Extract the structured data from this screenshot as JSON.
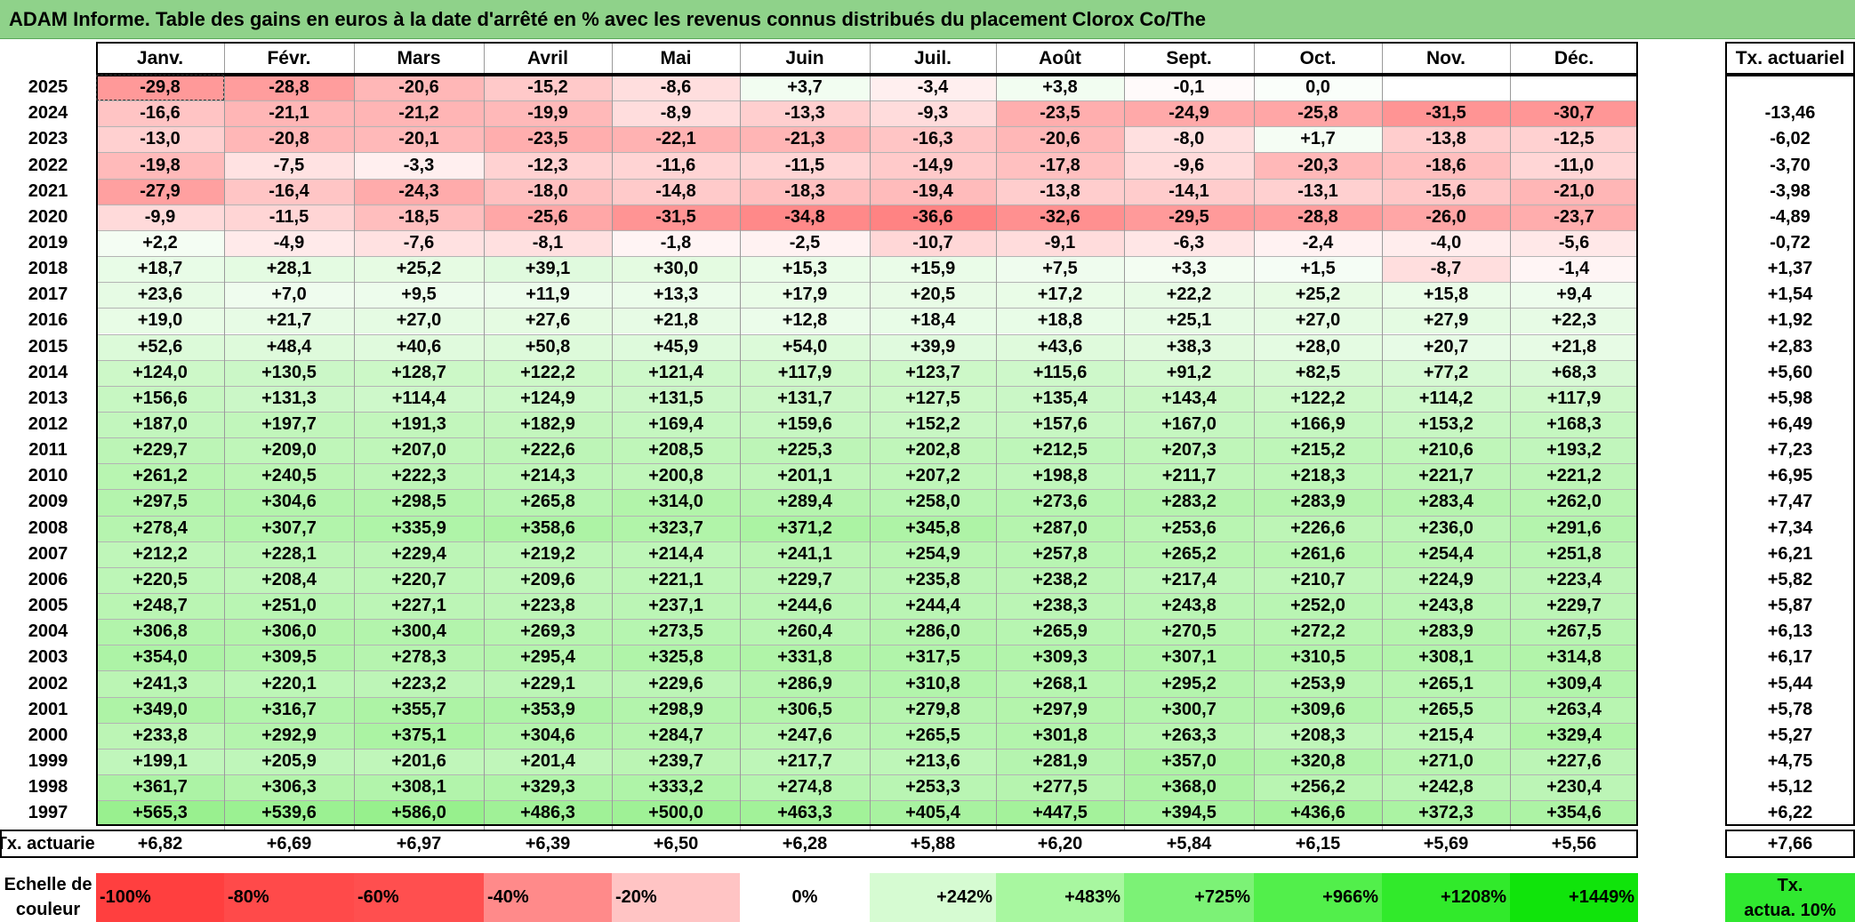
{
  "title": "ADAM Informe. Table des gains en euros à la date d'arrêté en % avec les revenus connus distribués du placement Clorox Co/The",
  "months": [
    "Janv.",
    "Févr.",
    "Mars",
    "Avril",
    "Mai",
    "Juin",
    "Juil.",
    "Août",
    "Sept.",
    "Oct.",
    "Nov.",
    "Déc."
  ],
  "tx_header": "Tx. actuariel",
  "rows": [
    {
      "year": "2025",
      "values": [
        "-29,8",
        "-28,8",
        "-20,6",
        "-15,2",
        "-8,6",
        "+3,7",
        "-3,4",
        "+3,8",
        "-0,1",
        "0,0",
        "",
        ""
      ],
      "tx": ""
    },
    {
      "year": "2024",
      "values": [
        "-16,6",
        "-21,1",
        "-21,2",
        "-19,9",
        "-8,9",
        "-13,3",
        "-9,3",
        "-23,5",
        "-24,9",
        "-25,8",
        "-31,5",
        "-30,7"
      ],
      "tx": "-13,46"
    },
    {
      "year": "2023",
      "values": [
        "-13,0",
        "-20,8",
        "-20,1",
        "-23,5",
        "-22,1",
        "-21,3",
        "-16,3",
        "-20,6",
        "-8,0",
        "+1,7",
        "-13,8",
        "-12,5"
      ],
      "tx": "-6,02"
    },
    {
      "year": "2022",
      "values": [
        "-19,8",
        "-7,5",
        "-3,3",
        "-12,3",
        "-11,6",
        "-11,5",
        "-14,9",
        "-17,8",
        "-9,6",
        "-20,3",
        "-18,6",
        "-11,0"
      ],
      "tx": "-3,70"
    },
    {
      "year": "2021",
      "values": [
        "-27,9",
        "-16,4",
        "-24,3",
        "-18,0",
        "-14,8",
        "-18,3",
        "-19,4",
        "-13,8",
        "-14,1",
        "-13,1",
        "-15,6",
        "-21,0"
      ],
      "tx": "-3,98"
    },
    {
      "year": "2020",
      "values": [
        "-9,9",
        "-11,5",
        "-18,5",
        "-25,6",
        "-31,5",
        "-34,8",
        "-36,6",
        "-32,6",
        "-29,5",
        "-28,8",
        "-26,0",
        "-23,7"
      ],
      "tx": "-4,89"
    },
    {
      "year": "2019",
      "values": [
        "+2,2",
        "-4,9",
        "-7,6",
        "-8,1",
        "-1,8",
        "-2,5",
        "-10,7",
        "-9,1",
        "-6,3",
        "-2,4",
        "-4,0",
        "-5,6"
      ],
      "tx": "-0,72"
    },
    {
      "year": "2018",
      "values": [
        "+18,7",
        "+28,1",
        "+25,2",
        "+39,1",
        "+30,0",
        "+15,3",
        "+15,9",
        "+7,5",
        "+3,3",
        "+1,5",
        "-8,7",
        "-1,4"
      ],
      "tx": "+1,37"
    },
    {
      "year": "2017",
      "values": [
        "+23,6",
        "+7,0",
        "+9,5",
        "+11,9",
        "+13,3",
        "+17,9",
        "+20,5",
        "+17,2",
        "+22,2",
        "+25,2",
        "+15,8",
        "+9,4"
      ],
      "tx": "+1,54"
    },
    {
      "year": "2016",
      "values": [
        "+19,0",
        "+21,7",
        "+27,0",
        "+27,6",
        "+21,8",
        "+12,8",
        "+18,4",
        "+18,8",
        "+25,1",
        "+27,0",
        "+27,9",
        "+22,3"
      ],
      "tx": "+1,92"
    },
    {
      "year": "2015",
      "values": [
        "+52,6",
        "+48,4",
        "+40,6",
        "+50,8",
        "+45,9",
        "+54,0",
        "+39,9",
        "+43,6",
        "+38,3",
        "+28,0",
        "+20,7",
        "+21,8"
      ],
      "tx": "+2,83"
    },
    {
      "year": "2014",
      "values": [
        "+124,0",
        "+130,5",
        "+128,7",
        "+122,2",
        "+121,4",
        "+117,9",
        "+123,7",
        "+115,6",
        "+91,2",
        "+82,5",
        "+77,2",
        "+68,3"
      ],
      "tx": "+5,60"
    },
    {
      "year": "2013",
      "values": [
        "+156,6",
        "+131,3",
        "+114,4",
        "+124,9",
        "+131,5",
        "+131,7",
        "+127,5",
        "+135,4",
        "+143,4",
        "+122,2",
        "+114,2",
        "+117,9"
      ],
      "tx": "+5,98"
    },
    {
      "year": "2012",
      "values": [
        "+187,0",
        "+197,7",
        "+191,3",
        "+182,9",
        "+169,4",
        "+159,6",
        "+152,2",
        "+157,6",
        "+167,0",
        "+166,9",
        "+153,2",
        "+168,3"
      ],
      "tx": "+6,49"
    },
    {
      "year": "2011",
      "values": [
        "+229,7",
        "+209,0",
        "+207,0",
        "+222,6",
        "+208,5",
        "+225,3",
        "+202,8",
        "+212,5",
        "+207,3",
        "+215,2",
        "+210,6",
        "+193,2"
      ],
      "tx": "+7,23"
    },
    {
      "year": "2010",
      "values": [
        "+261,2",
        "+240,5",
        "+222,3",
        "+214,3",
        "+200,8",
        "+201,1",
        "+207,2",
        "+198,8",
        "+211,7",
        "+218,3",
        "+221,7",
        "+221,2"
      ],
      "tx": "+6,95"
    },
    {
      "year": "2009",
      "values": [
        "+297,5",
        "+304,6",
        "+298,5",
        "+265,8",
        "+314,0",
        "+289,4",
        "+258,0",
        "+273,6",
        "+283,2",
        "+283,9",
        "+283,4",
        "+262,0"
      ],
      "tx": "+7,47"
    },
    {
      "year": "2008",
      "values": [
        "+278,4",
        "+307,7",
        "+335,9",
        "+358,6",
        "+323,7",
        "+371,2",
        "+345,8",
        "+287,0",
        "+253,6",
        "+226,6",
        "+236,0",
        "+291,6"
      ],
      "tx": "+7,34"
    },
    {
      "year": "2007",
      "values": [
        "+212,2",
        "+228,1",
        "+229,4",
        "+219,2",
        "+214,4",
        "+241,1",
        "+254,9",
        "+257,8",
        "+265,2",
        "+261,6",
        "+254,4",
        "+251,8"
      ],
      "tx": "+6,21"
    },
    {
      "year": "2006",
      "values": [
        "+220,5",
        "+208,4",
        "+220,7",
        "+209,6",
        "+221,1",
        "+229,7",
        "+235,8",
        "+238,2",
        "+217,4",
        "+210,7",
        "+224,9",
        "+223,4"
      ],
      "tx": "+5,82"
    },
    {
      "year": "2005",
      "values": [
        "+248,7",
        "+251,0",
        "+227,1",
        "+223,8",
        "+237,1",
        "+244,6",
        "+244,4",
        "+238,3",
        "+243,8",
        "+252,0",
        "+243,8",
        "+229,7"
      ],
      "tx": "+5,87"
    },
    {
      "year": "2004",
      "values": [
        "+306,8",
        "+306,0",
        "+300,4",
        "+269,3",
        "+273,5",
        "+260,4",
        "+286,0",
        "+265,9",
        "+270,5",
        "+272,2",
        "+283,9",
        "+267,5"
      ],
      "tx": "+6,13"
    },
    {
      "year": "2003",
      "values": [
        "+354,0",
        "+309,5",
        "+278,3",
        "+295,4",
        "+325,8",
        "+331,8",
        "+317,5",
        "+309,3",
        "+307,1",
        "+310,5",
        "+308,1",
        "+314,8"
      ],
      "tx": "+6,17"
    },
    {
      "year": "2002",
      "values": [
        "+241,3",
        "+220,1",
        "+223,2",
        "+229,1",
        "+229,6",
        "+286,9",
        "+310,8",
        "+268,1",
        "+295,2",
        "+253,9",
        "+265,1",
        "+309,4"
      ],
      "tx": "+5,44"
    },
    {
      "year": "2001",
      "values": [
        "+349,0",
        "+316,7",
        "+355,7",
        "+353,9",
        "+298,9",
        "+306,5",
        "+279,8",
        "+297,9",
        "+300,7",
        "+309,6",
        "+265,5",
        "+263,4"
      ],
      "tx": "+5,78"
    },
    {
      "year": "2000",
      "values": [
        "+233,8",
        "+292,9",
        "+375,1",
        "+304,6",
        "+284,7",
        "+247,6",
        "+265,5",
        "+301,8",
        "+263,3",
        "+208,3",
        "+215,4",
        "+329,4"
      ],
      "tx": "+5,27"
    },
    {
      "year": "1999",
      "values": [
        "+199,1",
        "+205,9",
        "+201,6",
        "+201,4",
        "+239,7",
        "+217,7",
        "+213,6",
        "+281,9",
        "+357,0",
        "+320,8",
        "+271,0",
        "+227,6"
      ],
      "tx": "+4,75"
    },
    {
      "year": "1998",
      "values": [
        "+361,7",
        "+306,3",
        "+308,1",
        "+329,3",
        "+333,2",
        "+274,8",
        "+253,3",
        "+277,5",
        "+368,0",
        "+256,2",
        "+242,8",
        "+230,4"
      ],
      "tx": "+5,12"
    },
    {
      "year": "1997",
      "values": [
        "+565,3",
        "+539,6",
        "+586,0",
        "+486,3",
        "+500,0",
        "+463,3",
        "+405,4",
        "+447,5",
        "+394,5",
        "+436,6",
        "+372,3",
        "+354,6"
      ],
      "tx": "+6,22"
    }
  ],
  "footer": {
    "label": "Tx. actuariel",
    "values": [
      "+6,82",
      "+6,69",
      "+6,97",
      "+6,39",
      "+6,50",
      "+6,28",
      "+5,88",
      "+6,20",
      "+5,84",
      "+6,15",
      "+5,69",
      "+5,56"
    ],
    "tx": "+7,66"
  },
  "legend": {
    "label_line1": "Echelle de",
    "label_line2": "couleur",
    "items": [
      {
        "label": "-100%",
        "color": "#ff3f3f"
      },
      {
        "label": "-80%",
        "color": "#ff4a4a"
      },
      {
        "label": "-60%",
        "color": "#ff4f4f"
      },
      {
        "label": "-40%",
        "color": "#ff8a8a"
      },
      {
        "label": "-20%",
        "color": "#ffc4c4"
      },
      {
        "label": "0%",
        "color": "#ffffff"
      },
      {
        "label": "+242%",
        "color": "#d6fbd2"
      },
      {
        "label": "+483%",
        "color": "#a8f7a0"
      },
      {
        "label": "+725%",
        "color": "#7cf276"
      },
      {
        "label": "+966%",
        "color": "#52ef4b"
      },
      {
        "label": "+1208%",
        "color": "#31ea2b"
      },
      {
        "label": "+1449%",
        "color": "#10e40b"
      }
    ],
    "tx_line1": "Tx.",
    "tx_line2": "actua. 10%",
    "tx_color": "#30e830"
  }
}
